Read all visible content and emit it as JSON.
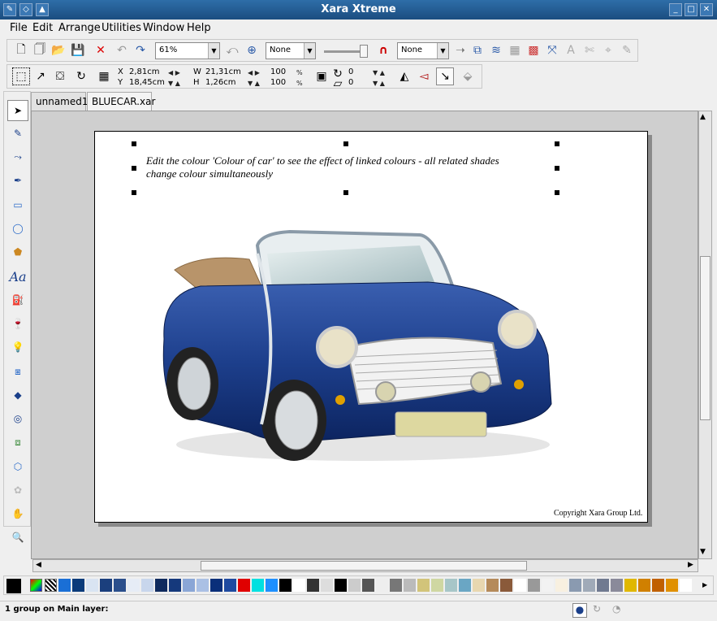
{
  "window": {
    "title": "Xara Xtreme"
  },
  "menu": [
    {
      "label": "File"
    },
    {
      "label": "Edit"
    },
    {
      "label": "Arrange"
    },
    {
      "label": "Utilities"
    },
    {
      "label": "Window"
    },
    {
      "label": "Help"
    }
  ],
  "toolbar": {
    "zoom": "61%",
    "feather_label": "None",
    "blend_label": "None"
  },
  "infobar": {
    "x_label": "X",
    "x_value": "2,81cm",
    "y_label": "Y",
    "y_value": "18,45cm",
    "w_label": "W",
    "w_value": "21,31cm",
    "h_label": "H",
    "h_value": "1,26cm",
    "scale_w": "100",
    "scale_h": "100",
    "rotate": "0",
    "skew": "0"
  },
  "tabs": [
    {
      "label": "unnamed1"
    },
    {
      "label": "BLUECAR.xar"
    }
  ],
  "document": {
    "caption_line1": "Edit the colour 'Colour of car' to see the effect of linked colours - all related shades",
    "caption_line2": "change colour simultaneously",
    "copyright": "Copyright Xara Group Ltd."
  },
  "palette": {
    "colors": [
      "#1a6fd6",
      "#0a3b7a",
      "#d9e4f2",
      "#1b3f7d",
      "#2b4f8c",
      "#e6ecf6",
      "#c8d6ec",
      "#0f2a5e",
      "#15397c",
      "#8aa6d6",
      "#aac0e4",
      "#0a2f7a",
      "#1e4aa0",
      "#e00000",
      "#00e0e0",
      "#1e90ff",
      "#000000",
      "#ffffff",
      "#333333",
      "#dddddd",
      "#000000",
      "#cccccc",
      "#555555",
      "#eeeeee",
      "#777777",
      "#bbbbbb",
      "#d2c47a",
      "#cfd7a2",
      "#a7c6c8",
      "#6aa6c4",
      "#e8d7b0",
      "#b58a5a",
      "#8a5a3a",
      "#ffffff",
      "#999999",
      "#f2f2f2",
      "#f8f0e0",
      "#8a9ab0",
      "#a0aab8",
      "#707a90",
      "#8a8a9a",
      "#e0b800",
      "#d08000",
      "#c06000",
      "#e09000",
      "#ffffff"
    ]
  },
  "status": {
    "text": "1 group on Main layer:"
  }
}
